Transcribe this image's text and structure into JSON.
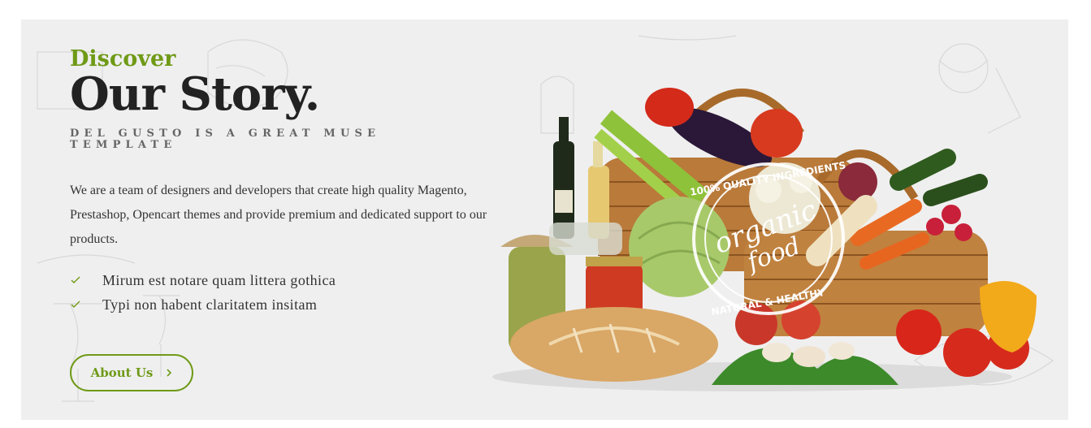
{
  "story": {
    "eyebrow": "Discover",
    "title": "Our Story.",
    "subtitle": "DEL GUSTO IS A GREAT MUSE TEMPLATE",
    "description": "We are a team of designers and developers that create high quality Magento, Prestashop, Opencart themes and provide premium and dedicated support to our products.",
    "features": [
      "Mirum est notare quam littera gothica",
      "Typi non habent claritatem insitam"
    ],
    "button_label": "About Us"
  },
  "image": {
    "description_icon": "vegetable-basket-image",
    "stamp_text_top": "100% QUALITY INGREDIENTS",
    "stamp_text_main_1": "organic",
    "stamp_text_main_2": "food",
    "stamp_text_bottom": "NATURAL & HEALTHY"
  },
  "colors": {
    "accent": "#6f9a17",
    "heading": "#222222",
    "background": "#efefef"
  }
}
